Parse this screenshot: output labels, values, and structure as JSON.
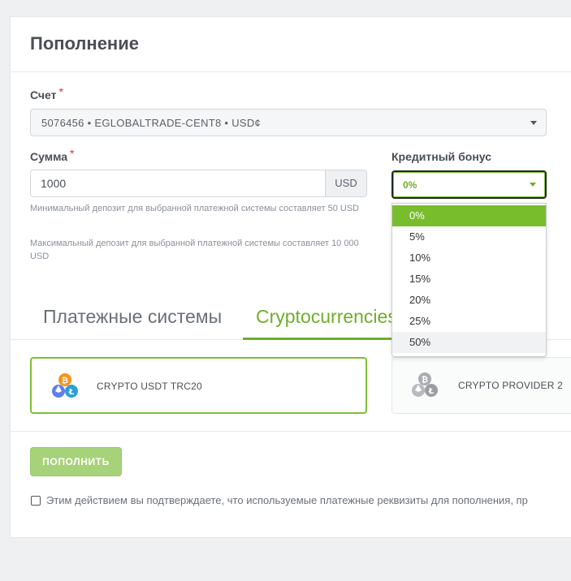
{
  "page": {
    "title": "Пополнение"
  },
  "account": {
    "label": "Счет",
    "required_mark": "*",
    "selected": "5076456 • EGLOBALTRADE-CENT8 • USD¢"
  },
  "amount": {
    "label": "Сумма",
    "required_mark": "*",
    "value": "1000",
    "currency": "USD",
    "min_hint": "Минимальный депозит для выбранной платежной системы составляет 50 USD",
    "max_hint": "Максимальный депозит для выбранной платежной системы составляет 10 000 USD"
  },
  "bonus": {
    "label": "Кредитный бонус",
    "selected": "0%",
    "options": [
      "0%",
      "5%",
      "10%",
      "15%",
      "20%",
      "25%",
      "50%"
    ],
    "highlighted_index": 0,
    "hover_index": 6
  },
  "tabs": [
    {
      "label": "Платежные системы",
      "active": false
    },
    {
      "label": "Cryptocurrencies",
      "active": true
    }
  ],
  "payment_methods": [
    {
      "name": "CRYPTO USDT TRC20",
      "icon": "crypto-coins-icon",
      "selected": true
    },
    {
      "name": "CRYPTO PROVIDER 2",
      "icon": "crypto-coins-gray-icon",
      "selected": false
    }
  ],
  "submit_label": "ПОПОЛНИТЬ",
  "consent_text": "Этим действием вы подтверждаете, что используемые платежные реквизиты для пополнения, пр",
  "colors": {
    "accent": "#78bd2c",
    "required": "#d9303b",
    "button_disabled": "#a6d279"
  }
}
